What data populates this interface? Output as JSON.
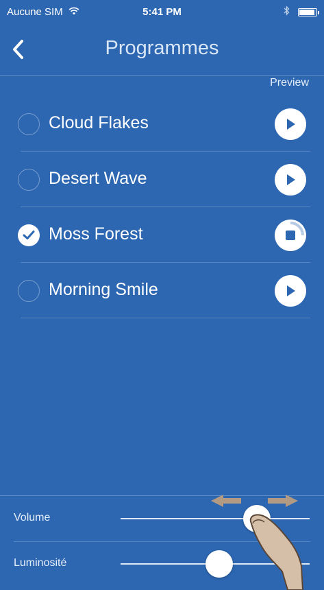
{
  "status_bar": {
    "carrier": "Aucune SIM",
    "time": "5:41 PM",
    "battery_level": 0.86
  },
  "nav": {
    "title": "Programmes"
  },
  "list": {
    "preview_header": "Preview",
    "items": [
      {
        "label": "Cloud Flakes",
        "selected": false,
        "playing": false
      },
      {
        "label": "Desert Wave",
        "selected": false,
        "playing": false
      },
      {
        "label": "Moss Forest",
        "selected": true,
        "playing": true
      },
      {
        "label": "Morning Smile",
        "selected": false,
        "playing": false
      }
    ]
  },
  "controls": {
    "volume_label": "Volume",
    "volume_value": 0.72,
    "luminosity_label": "Luminosité",
    "luminosity_value": 0.52
  },
  "colors": {
    "background": "#2d67b2",
    "foreground": "#ffffff"
  }
}
